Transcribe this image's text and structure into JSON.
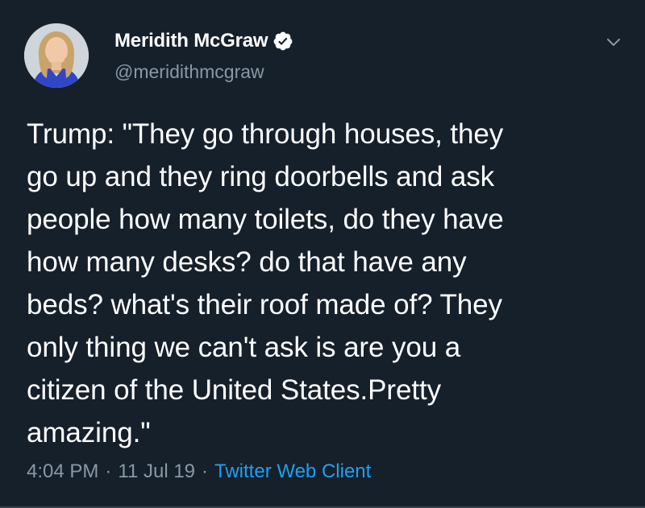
{
  "author": {
    "display_name": "Meridith McGraw",
    "handle": "@meridithmcgraw",
    "verified": true
  },
  "tweet": {
    "text": "Trump: \"They go through houses, they\ngo up and they ring doorbells and ask\npeople how many toilets, do they have\nhow many desks? do that have any\nbeds? what's their roof made of? They\nonly thing we can't ask is are you a\ncitizen of the United States.Pretty\namazing.\"",
    "time": "4:04 PM",
    "separator": "·",
    "date": "11 Jul 19",
    "source": "Twitter Web Client"
  },
  "colors": {
    "background": "#15202b",
    "text": "#ffffff",
    "muted": "#8899a6",
    "link": "#1da1f2"
  },
  "icons": {
    "verified": "verified-badge-icon",
    "menu": "chevron-down-icon"
  }
}
